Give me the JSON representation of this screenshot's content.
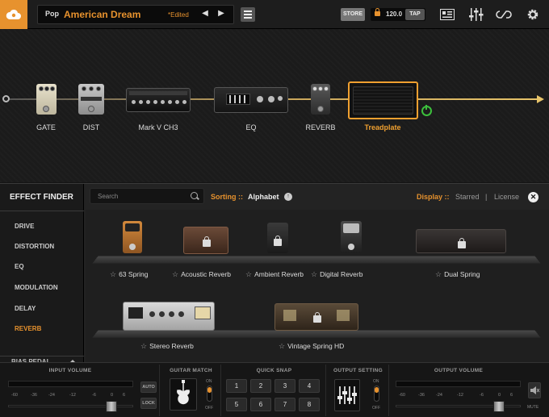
{
  "preset": {
    "bank": "Pop",
    "name": "American Dream",
    "edited": "*Edited"
  },
  "toolbar": {
    "store": "STORE",
    "tempo": "120.0",
    "tap": "TAP"
  },
  "chain": {
    "fx": [
      {
        "label": "GATE"
      },
      {
        "label": "DIST"
      },
      {
        "label": "Mark V CH3"
      },
      {
        "label": "EQ"
      },
      {
        "label": "REVERB"
      },
      {
        "label": "Treadplate"
      }
    ]
  },
  "finder": {
    "title": "EFFECT FINDER",
    "categories": [
      "DRIVE",
      "DISTORTION",
      "EQ",
      "MODULATION",
      "DELAY",
      "REVERB",
      "BIAS PEDAL"
    ],
    "active_category": "REVERB",
    "search_placeholder": "Search",
    "sorting_label": "Sorting ::",
    "sorting_value": "Alphabet",
    "display_label": "Display ::",
    "display_options": [
      "Starred",
      "License"
    ],
    "items": [
      {
        "name": "63 Spring",
        "locked": false
      },
      {
        "name": "Acoustic Reverb",
        "locked": true
      },
      {
        "name": "Ambient Reverb",
        "locked": true
      },
      {
        "name": "Digital Reverb",
        "locked": false
      },
      {
        "name": "Dual Spring",
        "locked": true
      },
      {
        "name": "Stereo Reverb",
        "locked": false
      },
      {
        "name": "Vintage Spring HD",
        "locked": true
      }
    ]
  },
  "bottom": {
    "input_volume": "INPUT VOLUME",
    "guitar_match": "GUITAR MATCH",
    "quick_snap": "QUICK SNAP",
    "output_setting": "OUTPUT SETTING",
    "output_volume": "OUTPUT VOLUME",
    "auto": "AUTO",
    "lock": "LOCK",
    "mute": "MUTE",
    "on": "ON",
    "off": "OFF",
    "scale": [
      "-60",
      "-36",
      "-24",
      "-12",
      "-6",
      "0",
      "6"
    ],
    "snaps": [
      "1",
      "2",
      "3",
      "4",
      "5",
      "6",
      "7",
      "8"
    ]
  },
  "colors": {
    "accent": "#e7922e",
    "power": "#3cbf3c"
  }
}
